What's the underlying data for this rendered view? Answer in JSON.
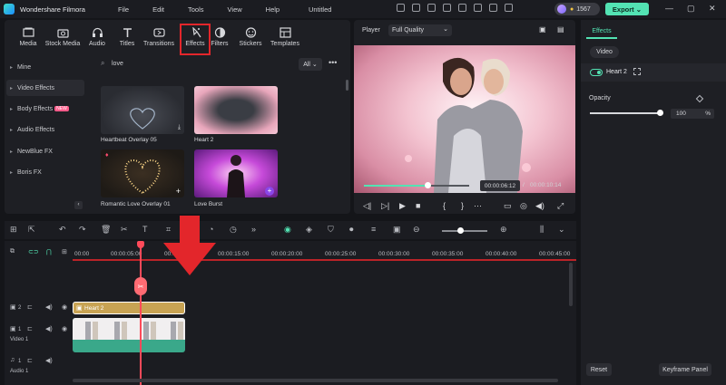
{
  "app": {
    "name": "Wondershare Filmora",
    "project_title": "Untitled",
    "menu": [
      "File",
      "Edit",
      "Tools",
      "View",
      "Help"
    ],
    "credits": "1567",
    "export_label": "Export"
  },
  "library": {
    "tabs": [
      {
        "label": "Media",
        "icon": "media-icon"
      },
      {
        "label": "Stock Media",
        "icon": "stock-media-icon"
      },
      {
        "label": "Audio",
        "icon": "audio-icon"
      },
      {
        "label": "Titles",
        "icon": "titles-icon"
      },
      {
        "label": "Transitions",
        "icon": "transitions-icon"
      },
      {
        "label": "Effects",
        "icon": "effects-icon",
        "active": true
      },
      {
        "label": "Filters",
        "icon": "filters-icon"
      },
      {
        "label": "Stickers",
        "icon": "stickers-icon"
      },
      {
        "label": "Templates",
        "icon": "templates-icon"
      }
    ],
    "sidebar": [
      {
        "label": "Mine"
      },
      {
        "label": "Video Effects"
      },
      {
        "label": "Body Effects",
        "badge": "NEW"
      },
      {
        "label": "Audio Effects"
      },
      {
        "label": "NewBlue FX"
      },
      {
        "label": "Boris FX"
      }
    ],
    "search_value": "love",
    "filter_label": "All",
    "cards": [
      {
        "label": "Heartbeat Overlay 05"
      },
      {
        "label": "Heart 2"
      },
      {
        "label": "Romantic Love Overlay 01"
      },
      {
        "label": "Love Burst"
      }
    ]
  },
  "player": {
    "label": "Player",
    "quality": "Full Quality",
    "current_time": "00:00:06:12",
    "separator": "/",
    "total_time": "00:00:10:14",
    "progress": 0.6
  },
  "properties": {
    "tab": "Effects",
    "subtab": "Video",
    "effect_name": "Heart 2",
    "opacity_label": "Opacity",
    "opacity_value": "100",
    "opacity_unit": "%",
    "reset_label": "Reset",
    "keyframe_label": "Keyframe Panel"
  },
  "timeline": {
    "ticks": [
      "00:00",
      "00:00:05:00",
      "00:00:10:00",
      "00:00:15:00",
      "00:00:20:00",
      "00:00:25:00",
      "00:00:30:00",
      "00:00:35:00",
      "00:00:40:00",
      "00:00:45:00"
    ],
    "effect_clip_label": "Heart 2",
    "track2_num": "2",
    "track1_num": "1",
    "video_track_label": "Video 1",
    "audio_track_num": "1",
    "audio_track_label": "Audio 1"
  },
  "colors": {
    "accent": "#53e3b3",
    "highlight_box": "#e3262b",
    "playhead": "#ff4a5a",
    "effect_clip": "#c8a353",
    "video_clip": "#3aa88a"
  }
}
